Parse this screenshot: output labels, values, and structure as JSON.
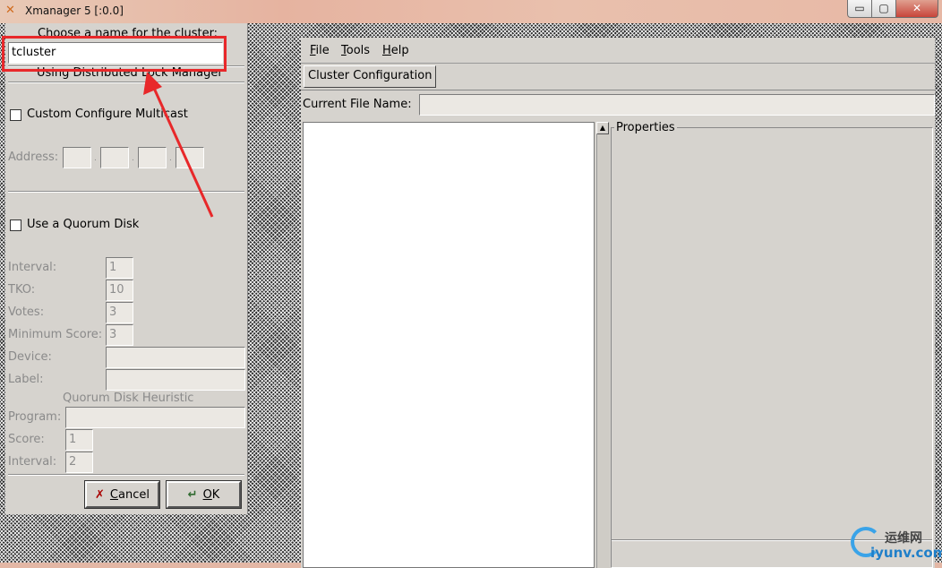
{
  "window": {
    "title": "Xmanager 5 [:0.0]",
    "min_glyph": "▭",
    "max_glyph": "▢",
    "close_glyph": "✕"
  },
  "dialog": {
    "cluster_name_label": "Choose a name for the cluster:",
    "cluster_name_value": "tcluster",
    "lock_manager_text": "Using Distributed Lock Manager",
    "multicast_label": "Custom Configure Multicast",
    "multicast_checked": false,
    "address_label": "Address:",
    "quorum_label": "Use a Quorum Disk",
    "quorum_checked": false,
    "interval_label": "Interval:",
    "interval_value": "1",
    "tko_label": "TKO:",
    "tko_value": "10",
    "votes_label": "Votes:",
    "votes_value": "3",
    "min_score_label": "Minimum Score:",
    "min_score_value": "3",
    "device_label": "Device:",
    "device_value": "",
    "label_label": "Label:",
    "label_value": "",
    "heuristic_title": "Quorum Disk Heuristic",
    "program_label": "Program:",
    "program_value": "",
    "score_label": "Score:",
    "score_value": "1",
    "h_interval_label": "Interval:",
    "h_interval_value": "2",
    "cancel_label": "Cancel",
    "ok_label": "OK"
  },
  "app": {
    "menu": [
      "File",
      "Tools",
      "Help"
    ],
    "tab_label": "Cluster Configuration",
    "file_name_label": "Current File Name:",
    "file_name_value": "",
    "properties_title": "Properties"
  },
  "watermark": {
    "cn": "运维网",
    "en": "iyunv.com"
  },
  "colors": {
    "annotation": "#e8282a",
    "title_bar": "#e6b3a0"
  }
}
